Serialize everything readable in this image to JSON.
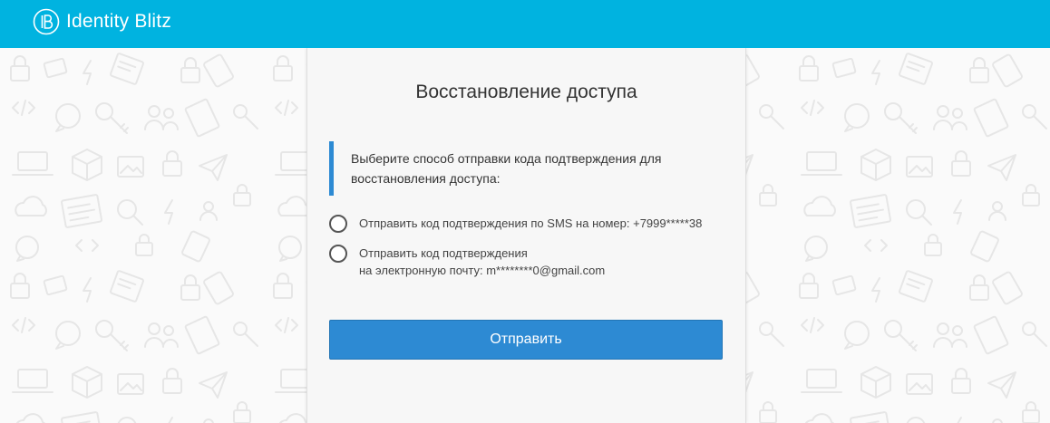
{
  "header": {
    "brand_name": "Identity Blitz",
    "background_color": "#00b3e0",
    "logo_icon": "identity-blitz-logo-icon"
  },
  "background": {
    "pattern_icons": [
      "lock-icon",
      "sms-bubble-icon",
      "key-icon",
      "users-icon",
      "laptop-icon",
      "cloud-icon",
      "document-icon",
      "lightning-icon",
      "tablet-icon",
      "box-icon",
      "code-icon",
      "send-icon",
      "image-icon"
    ]
  },
  "card": {
    "title": "Восстановление доступа",
    "info_text": "Выберите способ отправки кода подтверждения для восстановления доступа:",
    "accent_color": "#2d8ad3",
    "options": [
      {
        "line1": "Отправить код подтверждения по SMS на номер: +7999*****38",
        "line2": "",
        "selected": false
      },
      {
        "line1": "Отправить код подтверждения",
        "line2": "на электронную почту: m********0@gmail.com",
        "selected": false
      }
    ],
    "submit_label": "Отправить"
  }
}
